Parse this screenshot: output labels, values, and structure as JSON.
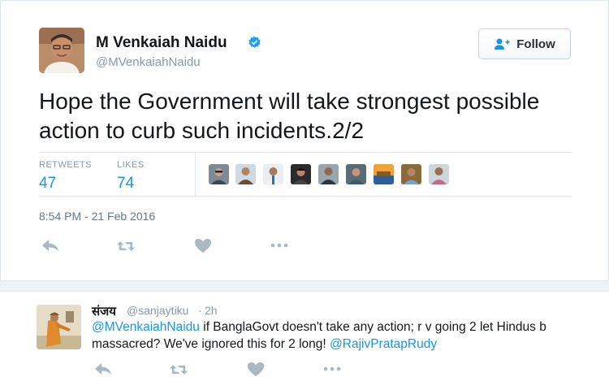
{
  "tweet": {
    "author": {
      "name": "M Venkaiah Naidu",
      "handle": "@MVenkaiahNaidu",
      "verified": true
    },
    "follow_label": "Follow",
    "text": "Hope the Government will take strongest possible action to curb such incidents.2/2",
    "stats": {
      "retweets_label": "RETWEETS",
      "retweets": "47",
      "likes_label": "LIKES",
      "likes": "74"
    },
    "timestamp": "8:54 PM - 21 Feb 2016",
    "actions": [
      "reply-icon",
      "retweet-icon",
      "like-icon",
      "more-icon"
    ]
  },
  "reply": {
    "name": "संजय",
    "handle": "@sanjaytiku",
    "separator": "·",
    "time": "2h",
    "mention_start": "@MVenkaiahNaidu",
    "text_middle": " if BanglaGovt doesn't take any action; r v going 2 let Hindus b massacred? We've ignored this for 2 long! ",
    "mention_end": "@RajivPratapRudy"
  },
  "colors": {
    "link": "#1b95e0",
    "muted": "#8899a6",
    "text": "#14171a",
    "icon": "#aab8c2"
  }
}
